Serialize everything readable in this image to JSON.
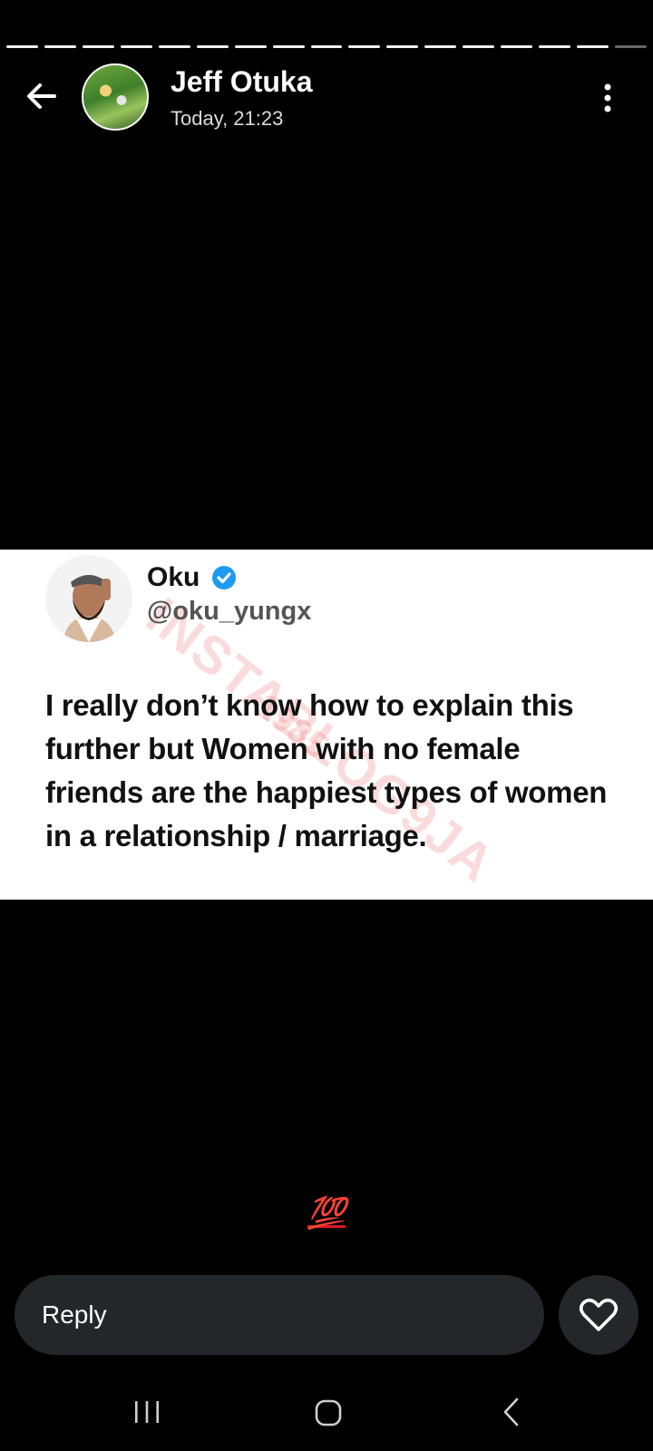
{
  "status": {
    "segment_count": 17,
    "contact_name": "Jeff Otuka",
    "timestamp": "Today, 21:23",
    "reply_placeholder": "Reply",
    "caption": "💯"
  },
  "post": {
    "author_name": "Oku",
    "author_handle": "@oku_yungx",
    "text": "I really don’t know how to explain this further but Women with no female friends are the happiest types of women in a relationship / marriage.",
    "watermark": "INSTABLOG9JA",
    "watermark_line2": "1985"
  },
  "colors": {
    "background": "#000000",
    "reply_bar": "#23272a",
    "verified": "#1d9bf0",
    "caption": "#e0162b"
  },
  "icons": {
    "back": "arrow-left-icon",
    "menu": "more-vertical-icon",
    "like": "heart-icon",
    "verified": "verified-badge-icon"
  }
}
